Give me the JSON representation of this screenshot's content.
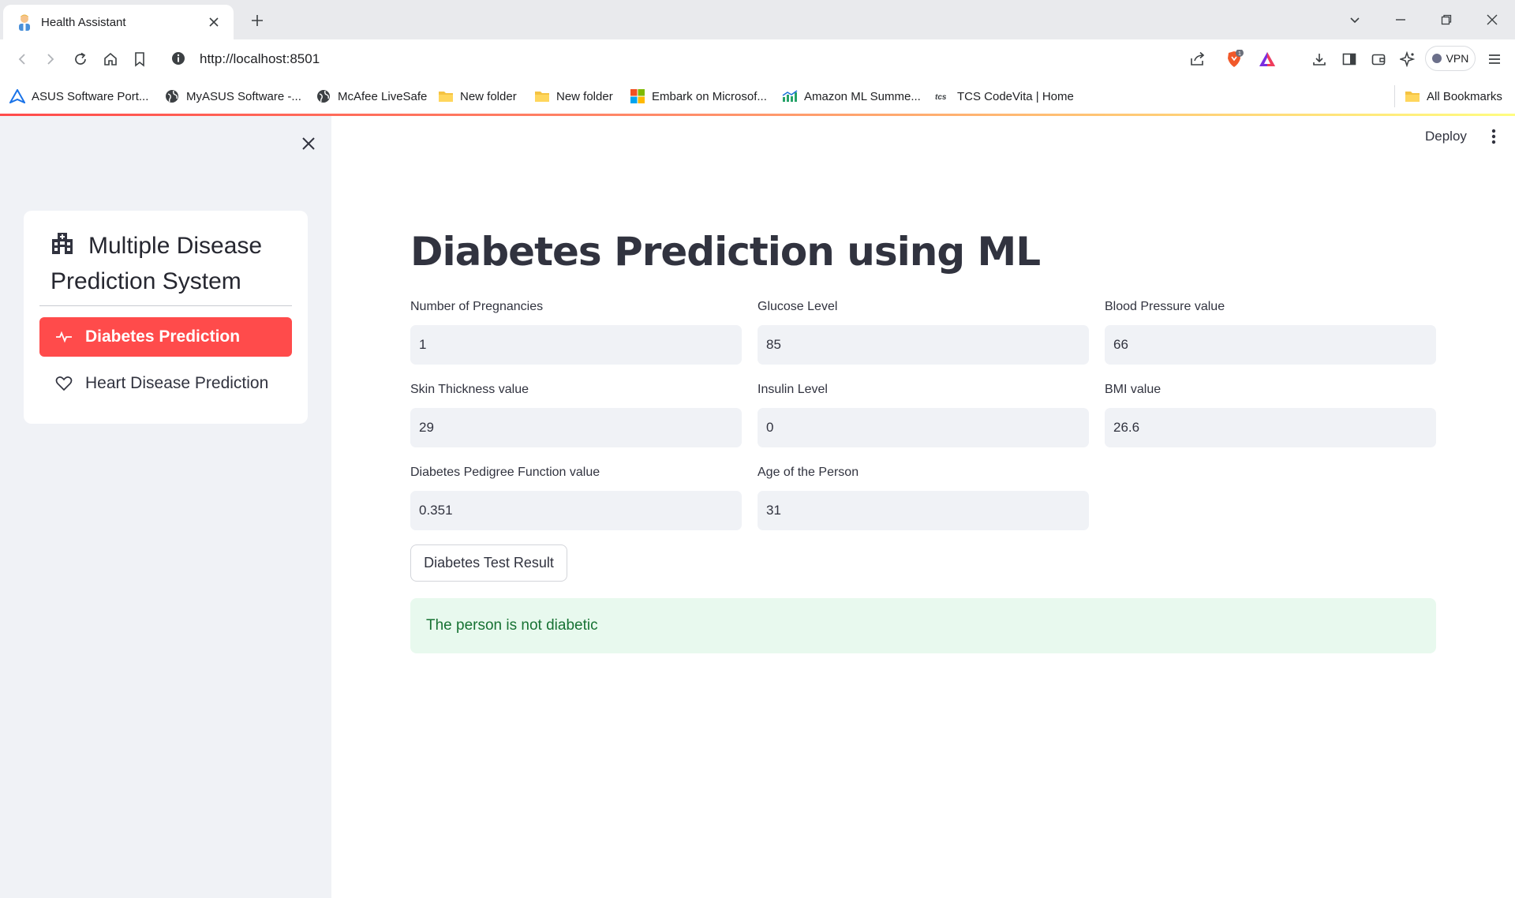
{
  "browser": {
    "tab_title": "Health Assistant",
    "url": "http://localhost:8501",
    "vpn_label": "VPN",
    "shield_badge": "1",
    "bookmarks": [
      {
        "label": "ASUS Software Port...",
        "icon": "asus-icon"
      },
      {
        "label": "MyASUS Software -...",
        "icon": "globe-icon"
      },
      {
        "label": "McAfee LiveSafe",
        "icon": "globe-icon"
      },
      {
        "label": "New folder",
        "icon": "folder-icon"
      },
      {
        "label": "New folder",
        "icon": "folder-icon"
      },
      {
        "label": "Embark on Microsof...",
        "icon": "microsoft-icon"
      },
      {
        "label": "Amazon ML Summe...",
        "icon": "chart-icon"
      },
      {
        "label": "TCS CodeVita | Home",
        "icon": "tcs-icon"
      }
    ],
    "all_bookmarks": "All Bookmarks"
  },
  "app": {
    "deploy_label": "Deploy",
    "accent_color": "#ff4b4b",
    "sidebar": {
      "menu_title": "Multiple Disease Prediction System",
      "items": [
        {
          "label": "Diabetes Prediction",
          "icon": "activity-icon",
          "active": true
        },
        {
          "label": "Heart Disease Prediction",
          "icon": "heart-icon",
          "active": false
        }
      ]
    },
    "main": {
      "title": "Diabetes Prediction using ML",
      "fields": [
        {
          "label": "Number of Pregnancies",
          "value": "1"
        },
        {
          "label": "Glucose Level",
          "value": "85"
        },
        {
          "label": "Blood Pressure value",
          "value": "66"
        },
        {
          "label": "Skin Thickness value",
          "value": "29"
        },
        {
          "label": "Insulin Level",
          "value": "0"
        },
        {
          "label": "BMI value",
          "value": "26.6"
        },
        {
          "label": "Diabetes Pedigree Function value",
          "value": "0.351"
        },
        {
          "label": "Age of the Person",
          "value": "31"
        }
      ],
      "button_label": "Diabetes Test Result",
      "result_text": "The person is not diabetic",
      "result_color": "#177233"
    }
  }
}
